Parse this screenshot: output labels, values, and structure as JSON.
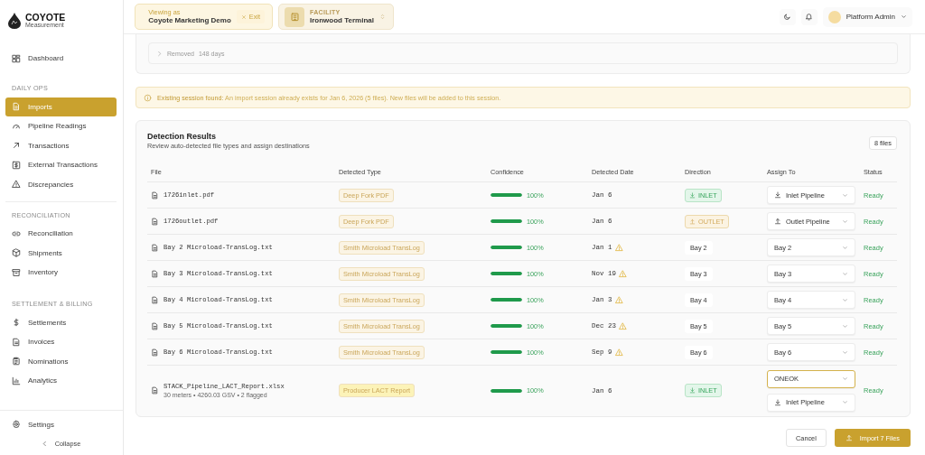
{
  "sidebar": {
    "brand": "COYOTE",
    "brand_subtitle": "Measurement",
    "sections": [
      {
        "items": [
          {
            "label": "Dashboard",
            "selected": false
          }
        ]
      },
      {
        "title": "DAILY OPS",
        "items": [
          {
            "label": "Imports",
            "selected": true
          },
          {
            "label": "Pipeline Readings",
            "selected": false
          },
          {
            "label": "Transactions",
            "selected": false
          },
          {
            "label": "External Transactions",
            "selected": false
          },
          {
            "label": "Discrepancies",
            "selected": false
          }
        ]
      },
      {
        "title": "RECONCILIATION",
        "items": [
          {
            "label": "Reconciliation",
            "selected": false
          },
          {
            "label": "Shipments",
            "selected": false
          },
          {
            "label": "Inventory",
            "selected": false
          }
        ]
      },
      {
        "title": "SETTLEMENT & BILLING",
        "items": [
          {
            "label": "Settlements",
            "selected": false
          },
          {
            "label": "Invoices",
            "selected": false
          },
          {
            "label": "Nominations",
            "selected": false
          },
          {
            "label": "Analytics",
            "selected": false
          }
        ]
      }
    ],
    "settings": "Settings",
    "collapse": "Collapse"
  },
  "topbar": {
    "viewing_label": "Viewing as",
    "viewing_name": "Coyote Marketing Demo",
    "exit": "Exit",
    "facility_label": "FACILITY",
    "facility_name": "Ironwood Terminal",
    "user": "Platform Admin"
  },
  "removed": {
    "label": "Removed",
    "detail": "148 days"
  },
  "alert": "**Existing session found:** An import session already exists for Jan 6, 2026 (5 files). New files will be added to this session.",
  "detection": {
    "title": "Detection Results",
    "subtitle": "Review auto-detected file types and assign destinations",
    "count": "8 files",
    "columns": [
      "File",
      "Detected Type",
      "Confidence",
      "Detected Date",
      "Direction",
      "Assign To",
      "Status"
    ],
    "rows": [
      {
        "file": "1726inlet.pdf",
        "type": {
          "label": "Deep Fork PDF",
          "color": "#fbf4e4"
        },
        "confidence": {
          "level": 1,
          "text": "100%"
        },
        "date": "Jan 6",
        "warning": false,
        "direction": {
          "kind": "inlet",
          "label": "INLET"
        },
        "assign": [
          {
            "kind": "inlet",
            "value": "Inlet Pipeline",
            "focused": false
          }
        ],
        "status": "Ready"
      },
      {
        "file": "1726outlet.pdf",
        "type": {
          "label": "Deep Fork PDF",
          "color": "#fbf4e4"
        },
        "confidence": {
          "level": 1,
          "text": "100%"
        },
        "date": "Jan 6",
        "warning": false,
        "direction": {
          "kind": "outlet",
          "label": "OUTLET"
        },
        "assign": [
          {
            "kind": "outlet",
            "value": "Outlet Pipeline",
            "focused": false
          }
        ],
        "status": "Ready"
      },
      {
        "file": "Bay 2 Microload-TransLog.txt",
        "type": {
          "label": "Smith Microload TransLog",
          "color": "#fbf4e4"
        },
        "confidence": {
          "level": 1,
          "text": "100%"
        },
        "date": "Jan 1",
        "warning": true,
        "direction": {
          "kind": "bay",
          "label": "Bay 2"
        },
        "assign": [
          {
            "kind": "plain",
            "value": "Bay 2",
            "focused": false
          }
        ],
        "status": "Ready"
      },
      {
        "file": "Bay 3 Microload-TransLog.txt",
        "type": {
          "label": "Smith Microload TransLog",
          "color": "#fbf4e4"
        },
        "confidence": {
          "level": 1,
          "text": "100%"
        },
        "date": "Nov 19",
        "warning": true,
        "direction": {
          "kind": "bay",
          "label": "Bay 3"
        },
        "assign": [
          {
            "kind": "plain",
            "value": "Bay 3",
            "focused": false
          }
        ],
        "status": "Ready"
      },
      {
        "file": "Bay 4 Microload-TransLog.txt",
        "type": {
          "label": "Smith Microload TransLog",
          "color": "#fbf4e4"
        },
        "confidence": {
          "level": 1,
          "text": "100%"
        },
        "date": "Jan 3",
        "warning": true,
        "direction": {
          "kind": "bay",
          "label": "Bay 4"
        },
        "assign": [
          {
            "kind": "plain",
            "value": "Bay 4",
            "focused": false
          }
        ],
        "status": "Ready"
      },
      {
        "file": "Bay 5 Microload-TransLog.txt",
        "type": {
          "label": "Smith Microload TransLog",
          "color": "#fbf4e4"
        },
        "confidence": {
          "level": 1,
          "text": "100%"
        },
        "date": "Dec 23",
        "warning": true,
        "direction": {
          "kind": "bay",
          "label": "Bay 5"
        },
        "assign": [
          {
            "kind": "plain",
            "value": "Bay 5",
            "focused": false
          }
        ],
        "status": "Ready"
      },
      {
        "file": "Bay 6 Microload-TransLog.txt",
        "type": {
          "label": "Smith Microload TransLog",
          "color": "#fbf4e4"
        },
        "confidence": {
          "level": 1,
          "text": "100%"
        },
        "date": "Sep 9",
        "warning": true,
        "direction": {
          "kind": "bay",
          "label": "Bay 6"
        },
        "assign": [
          {
            "kind": "plain",
            "value": "Bay 6",
            "focused": false
          }
        ],
        "status": "Ready"
      },
      {
        "file": "STACK_Pipeline_LACT_Report.xlsx",
        "meta": "30 meters • 4260.03 GSV • 2 flagged",
        "type": {
          "label": "Producer LACT Report",
          "color": "#fcf3b8"
        },
        "confidence": {
          "level": 1,
          "text": "100%"
        },
        "date": "Jan 6",
        "warning": false,
        "direction": {
          "kind": "inlet",
          "label": "INLET"
        },
        "assign": [
          {
            "kind": "plain",
            "value": "ONEOK",
            "focused": true
          },
          {
            "kind": "inlet",
            "value": "Inlet Pipeline",
            "focused": false
          }
        ],
        "status": "Ready"
      }
    ]
  },
  "actions": {
    "cancel": "Cancel",
    "import": "Import 7 Files"
  }
}
